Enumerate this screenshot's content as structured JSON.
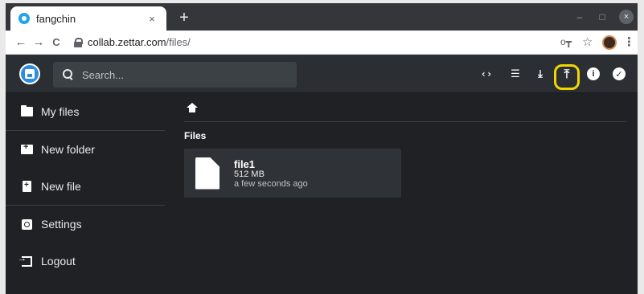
{
  "browser": {
    "tab_title": "fangchin",
    "tab_close": "×",
    "new_tab": "+",
    "window_minimize": "–",
    "window_maximize": "□",
    "window_close": "×",
    "back": "←",
    "forward": "→",
    "reload": "C",
    "url_host": "collab.zettar.com",
    "url_path": "/files/",
    "key": "o┳",
    "star": "☆",
    "menu": "⋮"
  },
  "header": {
    "search_placeholder": "Search...",
    "code_icon": "‹›",
    "list_icon": "☰",
    "download_icon": "⤓",
    "upload_icon": "⤒",
    "info_icon": "i",
    "select_icon": "✓",
    "highlight_color": "#f2d600"
  },
  "sidebar": {
    "items": [
      {
        "label": "My files",
        "icon": "folder-icon"
      },
      {
        "label": "New folder",
        "icon": "new-folder-icon"
      },
      {
        "label": "New file",
        "icon": "new-file-icon"
      },
      {
        "label": "Settings",
        "icon": "settings-icon"
      },
      {
        "label": "Logout",
        "icon": "logout-icon"
      }
    ]
  },
  "main": {
    "section_title": "Files",
    "files": [
      {
        "name": "file1",
        "size": "512 MB",
        "modified": "a few seconds ago"
      }
    ]
  },
  "colors": {
    "background": "#202124",
    "header": "#2b2f33",
    "card": "#2f3337",
    "accent": "#2d8ce0"
  }
}
